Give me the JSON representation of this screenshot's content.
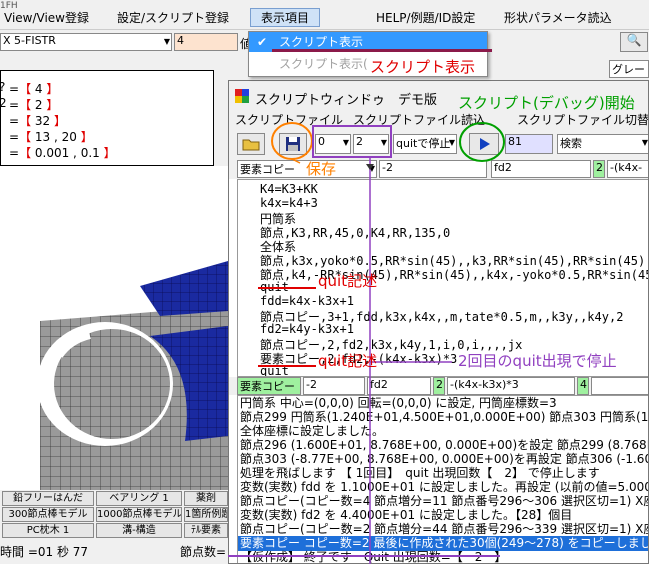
{
  "menu": {
    "items": [
      "View/View登録",
      "設定/スクリプト登録",
      "表示項目",
      "HELP/例題/ID設定",
      "形状パラメータ読込"
    ],
    "window_fragment": "1FH"
  },
  "toolbar": {
    "model_select": "X 5-FISTR",
    "value_box": "4",
    "cut_label": "値",
    "search_icon_char": "🔍",
    "gray_label": "グレー"
  },
  "dropdown": {
    "items": [
      {
        "label": "スクリプト表示",
        "checked": true
      },
      {
        "label": "スクリプト表示(",
        "checked": false
      }
    ]
  },
  "left_panel": {
    "lines": [
      "=【 4 】",
      "=【 2 】",
      "=【 32 】",
      "=【 13 , 20 】",
      "=【 0.001 , 0.1 】"
    ],
    "prefixes": [
      "?",
      "2",
      "",
      "",
      ""
    ]
  },
  "bottom_buttons": [
    [
      "鉛フリーはんだ",
      "ベアリング 1",
      "薬剤"
    ],
    [
      "300節点棒モデル",
      "1000節点棒モデル",
      "1箇所例題"
    ],
    [
      "PC枕木 1",
      "溝-構造",
      "ﾃﾙ要素"
    ]
  ],
  "status": {
    "time": "時間 =01 秒 77",
    "node": "節点数="
  },
  "script_window": {
    "title": "スクリプトウィンドゥ　デモ版",
    "menu": [
      "スクリプトファイル",
      "スクリプトファイル読込",
      "スクリプトファイル切替"
    ],
    "toolbar": {
      "combo1": "0",
      "combo2": "2",
      "quit_select": "quitで停止",
      "line_no": "81",
      "search": "検索"
    },
    "row1": {
      "select": "要素コピー",
      "f1": "-2",
      "f2": "fd2",
      "f3": "2",
      "f4": "-(k4x-"
    },
    "code_lines": [
      "K4=K3+KK",
      "k4x=k4+3",
      "円筒系",
      "節点,K3,RR,45,0,K4,RR,135,0",
      "全体系",
      "節点,k3x,yoko*0.5,RR*sin(45),,k3,RR*sin(45),RR*sin(45)",
      "節点,k4,-RR*sin(45),RR*sin(45),,k4x,-yoko*0.5,RR*sin(45)",
      "quit",
      "fdd=k4x-k3x+1",
      "節点コピー,3+1,fdd,k3x,k4x,,m,tate*0.5,m,,k3y,,k4y,2",
      "fd2=k4y-k3x+1",
      "節点コピー,2,fd2,k3x,k4y,1,i,0,i,,,,jx",
      "要素コピー,2,fd2,-(k4x-k3x)*3",
      "quit"
    ],
    "row2": {
      "select": "要素コピー",
      "f1": "-2",
      "f2": "fd2",
      "f3": "2",
      "f4": "-(k4x-k3x)*3",
      "f5": "4"
    },
    "output_lines": [
      "円筒系 中心=(0,0,0) 回転=(0,0,0) に設定, 円筒座標数=3",
      "節点299 円筒系(1.240E+01,4.500E+01,0.000E+00) 節点303 円筒系(1.24",
      "全体座標に設定しました。",
      "節点296 (1.600E+01, 8.768E+00, 0.000E+00)を設定 節点299 (8.768E+00",
      "節点303 (-8.77E+00, 8.768E+00, 0.000E+00)を再設定 節点306 (-1.60E+0",
      "処理を飛ばします 【 1回目】　quit 出現回数【　2】 で停止します",
      "変数(実数) fdd を 1.1000E+01 に設定しました。再設定 (以前の値=5.000",
      "節点コピー(コピー数=4 節点増分=11 節点番号296～306  選択区切=1) X座",
      "変数(実数) fd2 を 4.4000E+01 に設定しました。【28】個目",
      "節点コピー(コピー数=2 節点増分=44 節点番号296～339  選択区切=1) X座",
      "要素コピー コピー数=2 最後に作成された30個(249～278) をコピーしました",
      "【仮作成】 終了です　Quit 出現回数=【　2　】"
    ]
  },
  "annotations": {
    "script_display": "スクリプト表示",
    "debug_start": "スクリプト(デバッグ)開始",
    "save": "保存",
    "quit_desc1": "quit記述",
    "quit_desc2": "quit記述",
    "stop_on_second": "2回目のquit出現で停止"
  },
  "colors": {
    "annotation_red": "#e00000",
    "annotation_green": "#00a000",
    "annotation_orange": "#ff8000",
    "annotation_purple": "#9040c0",
    "selected_line": "#1e6fd9"
  }
}
